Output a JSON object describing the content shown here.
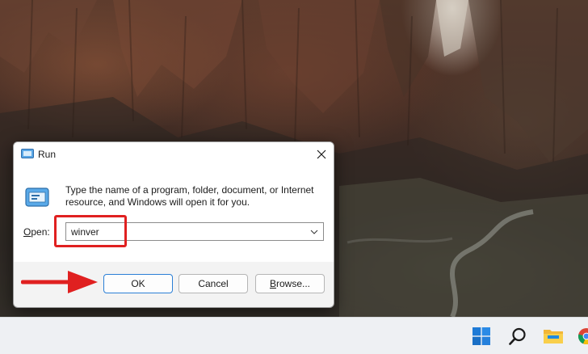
{
  "dialog": {
    "title": "Run",
    "description": "Type the name of a program, folder, document, or Internet resource, and Windows will open it for you.",
    "open_label_mnemonic": "O",
    "open_label_rest": "pen:",
    "open_value": "winver",
    "close_symbol": "✕"
  },
  "buttons": {
    "ok": "OK",
    "cancel": "Cancel",
    "browse_mnemonic": "B",
    "browse_rest": "rowse..."
  },
  "colors": {
    "annotation_red": "#e02020",
    "primary_button_border": "#2b7fd6",
    "taskbar_bg": "#eef0f3"
  },
  "taskbar": {
    "icons": [
      "windows-start-icon",
      "search-icon",
      "file-explorer-icon",
      "chrome-icon"
    ]
  }
}
